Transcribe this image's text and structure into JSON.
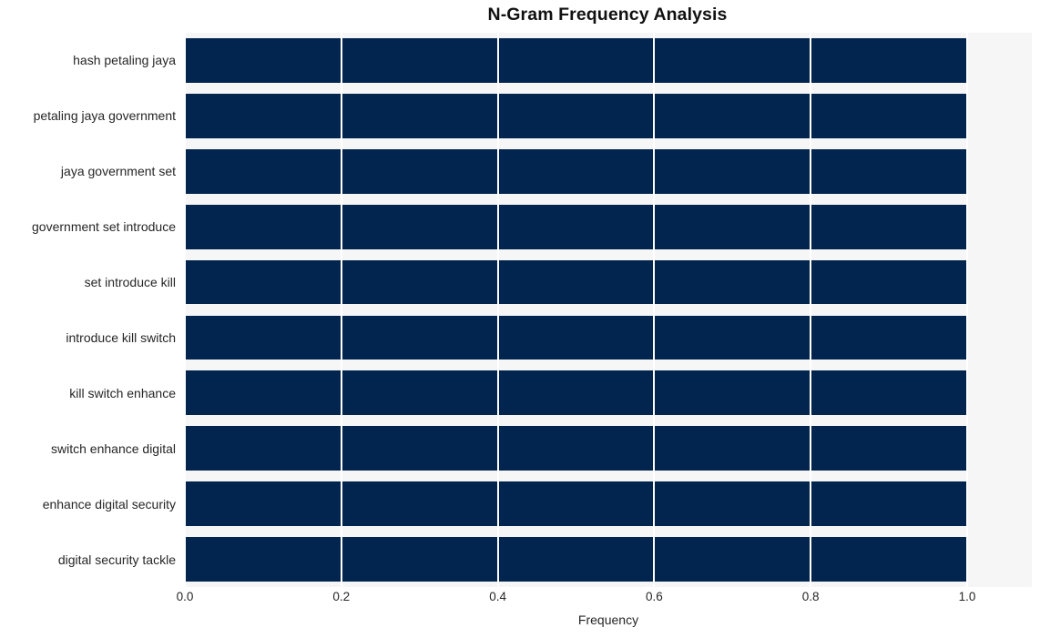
{
  "chart_data": {
    "type": "bar",
    "orientation": "horizontal",
    "title": "N-Gram Frequency Analysis",
    "xlabel": "Frequency",
    "ylabel": "",
    "categories": [
      "hash petaling jaya",
      "petaling jaya government",
      "jaya government set",
      "government set introduce",
      "set introduce kill",
      "introduce kill switch",
      "kill switch enhance",
      "switch enhance digital",
      "enhance digital security",
      "digital security tackle"
    ],
    "values": [
      1.0,
      1.0,
      1.0,
      1.0,
      1.0,
      1.0,
      1.0,
      1.0,
      1.0,
      1.0
    ],
    "xlim": [
      0.0,
      1.0827
    ],
    "xticks": [
      "0.0",
      "0.2",
      "0.4",
      "0.6",
      "0.8",
      "1.0"
    ],
    "xtick_values": [
      0.0,
      0.2,
      0.4,
      0.6,
      0.8,
      1.0
    ],
    "grid": "vertical",
    "legend": "none",
    "bar_color": "#01254f",
    "plot_background": "#f6f6f7",
    "gridline_color": "#ffffff",
    "figure_background": "#ffffff",
    "text_color": "#262626",
    "title_color": "#111111"
  }
}
